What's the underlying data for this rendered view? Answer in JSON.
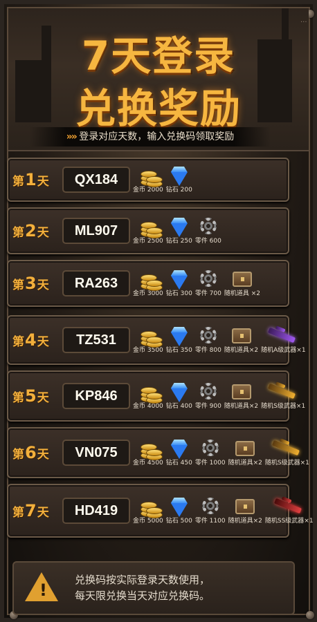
{
  "header": {
    "title_line1": "7天登录",
    "title_line2": "兑换奖励",
    "subtitle": "登录对应天数，输入兑换码领取奖励",
    "subtitle_arrows": "»»"
  },
  "days": [
    {
      "prefix": "第",
      "num": "1",
      "suffix": "天",
      "code": "QX184",
      "rewards": [
        {
          "type": "coin",
          "label": "金币 2000"
        },
        {
          "type": "gem",
          "label": "钻石 200"
        }
      ]
    },
    {
      "prefix": "第",
      "num": "2",
      "suffix": "天",
      "code": "ML907",
      "rewards": [
        {
          "type": "coin",
          "label": "金币 2500"
        },
        {
          "type": "gem",
          "label": "钻石 250"
        },
        {
          "type": "gear",
          "label": "零件 600"
        }
      ]
    },
    {
      "prefix": "第",
      "num": "3",
      "suffix": "天",
      "code": "RA263",
      "rewards": [
        {
          "type": "coin",
          "label": "金币 3000"
        },
        {
          "type": "gem",
          "label": "钻石 300"
        },
        {
          "type": "gear",
          "label": "零件 700"
        },
        {
          "type": "chest",
          "label": "随机道具 ×2"
        }
      ]
    },
    {
      "prefix": "第",
      "num": "4",
      "suffix": "天",
      "code": "TZ531",
      "rewards": [
        {
          "type": "coin",
          "label": "金币 3500"
        },
        {
          "type": "gem",
          "label": "钻石 350"
        },
        {
          "type": "gear",
          "label": "零件 800"
        },
        {
          "type": "chest",
          "label": "随机道具×2"
        },
        {
          "type": "gun-a",
          "label": "随机A级武器×1"
        }
      ]
    },
    {
      "prefix": "第",
      "num": "5",
      "suffix": "天",
      "code": "KP846",
      "rewards": [
        {
          "type": "coin",
          "label": "金币 4000"
        },
        {
          "type": "gem",
          "label": "钻石 400"
        },
        {
          "type": "gear",
          "label": "零件 900"
        },
        {
          "type": "chest",
          "label": "随机道具×2"
        },
        {
          "type": "gun-s",
          "label": "随机S级武器×1"
        }
      ]
    },
    {
      "prefix": "第",
      "num": "6",
      "suffix": "天",
      "code": "VN075",
      "rewards": [
        {
          "type": "coin",
          "label": "金币 4500"
        },
        {
          "type": "gem",
          "label": "钻石 450"
        },
        {
          "type": "gear",
          "label": "零件 1000"
        },
        {
          "type": "chest",
          "label": "随机道具×2"
        },
        {
          "type": "gun-s",
          "label": "随机S级武器×1"
        }
      ]
    },
    {
      "prefix": "第",
      "num": "7",
      "suffix": "天",
      "code": "HD419",
      "rewards": [
        {
          "type": "coin",
          "label": "金币 5000"
        },
        {
          "type": "gem",
          "label": "钻石 500"
        },
        {
          "type": "gear",
          "label": "零件 1100"
        },
        {
          "type": "chest",
          "label": "随机道具×2"
        },
        {
          "type": "gun-ss",
          "label": "随机SS级武器×1"
        }
      ]
    }
  ],
  "notice": {
    "line1": "兑换码按实际登录天数使用，",
    "line2": "每天限兑换当天对应兑换码。",
    "warning_icon": "warning-triangle-icon"
  },
  "corner_hint": "..."
}
